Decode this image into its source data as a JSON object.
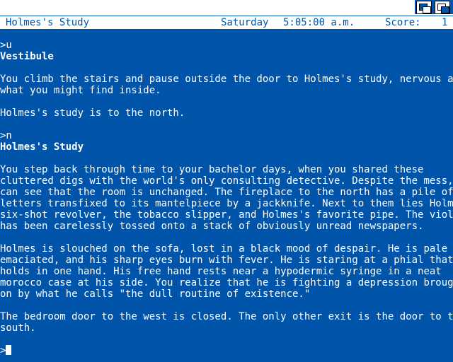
{
  "window": {
    "gadgets": [
      "depth-back-icon",
      "depth-front-icon"
    ]
  },
  "status": {
    "location": "Holmes's Study",
    "day": "Saturday",
    "time": "5:05:00 a.m.",
    "score_label": "Score:",
    "score_value": "1"
  },
  "transcript": {
    "cmd1": ">u",
    "room1_title": "Vestibule",
    "room1_desc": [
      "You climb the stairs and pause outside the door to Holmes's study, nervous about",
      "what you might find inside."
    ],
    "room1_exit": "Holmes's study is to the north.",
    "cmd2": ">n",
    "room2_title": "Holmes's Study",
    "room2_desc": [
      "You step back through time to your bachelor days, when you shared these",
      "cluttered digs with the world's only consulting detective. Despite the mess, you",
      "can see that the room is unchanged. The fireplace to the north has a pile of",
      "letters transfixed to its mantelpiece by a jackknife. Next to them lies Holmes's",
      "six-shot revolver, the tobacco slipper, and Holmes's favorite pipe. The violin",
      "has been carelessly tossed onto a stack of obviously unread newspapers."
    ],
    "room2_holmes": [
      "Holmes is slouched on the sofa, lost in a black mood of despair. He is pale and",
      "emaciated, and his sharp eyes burn with fever. He is staring at a phial that he",
      "holds in one hand. His free hand rests near a hypodermic syringe in a neat",
      "morocco case at his side. You realize that he is fighting a depression brought",
      "on by what he calls \"the dull routine of existence.\""
    ],
    "room2_exits": [
      "The bedroom door to the west is closed. The only other exit is the door to the",
      "south."
    ],
    "prompt": ">"
  }
}
